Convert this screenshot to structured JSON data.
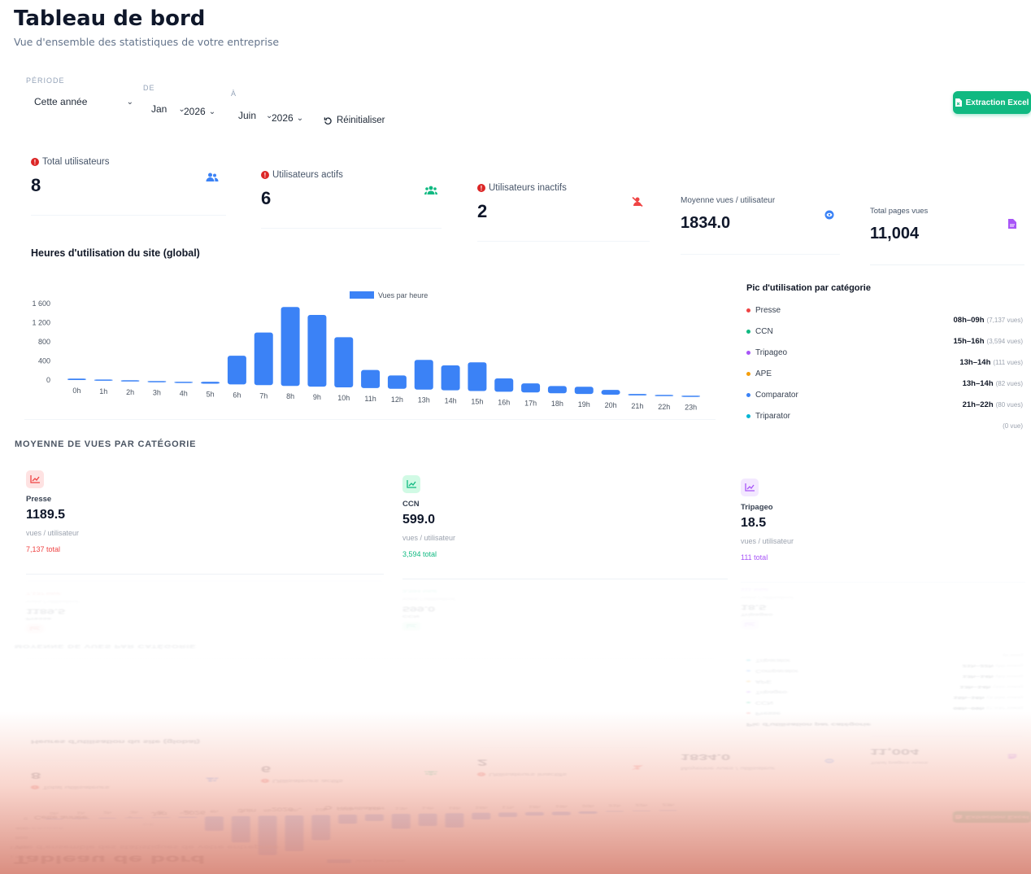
{
  "page": {
    "title": "Tableau de bord",
    "subtitle": "Vue d'ensemble des statistiques de votre entreprise"
  },
  "filters": {
    "periode_label": "PÉRIODE",
    "periode_value": "Cette année",
    "de_label": "DE",
    "de_month": "Jan",
    "de_year": "2026",
    "a_label": "À",
    "a_month": "Juin",
    "a_year": "2026",
    "reset_label": "Réinitialiser",
    "excel_label": "Extraction Excel"
  },
  "stats": [
    {
      "label": "Total utilisateurs",
      "value": "8",
      "icon": "users-icon",
      "color": "#3b82f6",
      "warn": true
    },
    {
      "label": "Utilisateurs actifs",
      "value": "6",
      "icon": "users-active-icon",
      "color": "#10b981",
      "warn": true
    },
    {
      "label": "Utilisateurs inactifs",
      "value": "2",
      "icon": "user-slash-icon",
      "color": "#ef4444",
      "warn": true
    },
    {
      "label": "Moyenne vues / utilisateur",
      "value": "1834.0",
      "icon": "eye-icon",
      "color": "#3b82f6",
      "warn": false
    },
    {
      "label": "Total pages vues",
      "value": "11,004",
      "icon": "file-icon",
      "color": "#a855f7",
      "warn": false
    }
  ],
  "chart_title": "Heures d'utilisation du site (global)",
  "chart_data": {
    "type": "bar",
    "title": "Heures d'utilisation du site (global)",
    "xlabel": "",
    "ylabel": "",
    "categories": [
      "0h",
      "1h",
      "2h",
      "3h",
      "4h",
      "5h",
      "6h",
      "7h",
      "8h",
      "9h",
      "10h",
      "11h",
      "12h",
      "13h",
      "14h",
      "15h",
      "16h",
      "17h",
      "18h",
      "19h",
      "20h",
      "21h",
      "22h",
      "23h"
    ],
    "series": [
      {
        "name": "Vues par heure",
        "color": "#3b82f6",
        "values": [
          30,
          8,
          6,
          4,
          10,
          40,
          600,
          1100,
          1650,
          1500,
          1050,
          380,
          280,
          620,
          520,
          600,
          280,
          190,
          150,
          150,
          100,
          30,
          10,
          8
        ]
      }
    ],
    "yticks": [
      "0",
      "400",
      "800",
      "1 200",
      "1 600"
    ],
    "ylim": [
      0,
      1600
    ],
    "grid": false,
    "legend": "top"
  },
  "peaks": {
    "title": "Pic d'utilisation par catégorie",
    "names": [
      {
        "name": "Presse",
        "color": "#ef4444"
      },
      {
        "name": "CCN",
        "color": "#10b981"
      },
      {
        "name": "Tripageo",
        "color": "#a855f7"
      },
      {
        "name": "APE",
        "color": "#f59e0b"
      },
      {
        "name": "Comparator",
        "color": "#3b82f6"
      },
      {
        "name": "Triparator",
        "color": "#06b6d4"
      }
    ],
    "values": [
      {
        "range": "08h–09h",
        "views": "(7,137 vues)"
      },
      {
        "range": "15h–16h",
        "views": "(3,594 vues)"
      },
      {
        "range": "13h–14h",
        "views": "(111 vues)"
      },
      {
        "range": "13h–14h",
        "views": "(82 vues)"
      },
      {
        "range": "21h–22h",
        "views": "(80 vues)"
      },
      {
        "range": "",
        "views": "(0 vue)"
      }
    ]
  },
  "categories_section": {
    "title": "MOYENNE DE VUES PAR CATÉGORIE",
    "items": [
      {
        "name": "Presse",
        "value": "1189.5",
        "unit": "vues / utilisateur",
        "total": "7,137 total",
        "color": "#ef4444",
        "icon": "chart-line-icon"
      },
      {
        "name": "CCN",
        "value": "599.0",
        "unit": "vues / utilisateur",
        "total": "3,594 total",
        "color": "#10b981",
        "icon": "chart-line-icon"
      },
      {
        "name": "Tripageo",
        "value": "18.5",
        "unit": "vues / utilisateur",
        "total": "111 total",
        "color": "#a855f7",
        "icon": "chart-line-icon"
      }
    ]
  }
}
